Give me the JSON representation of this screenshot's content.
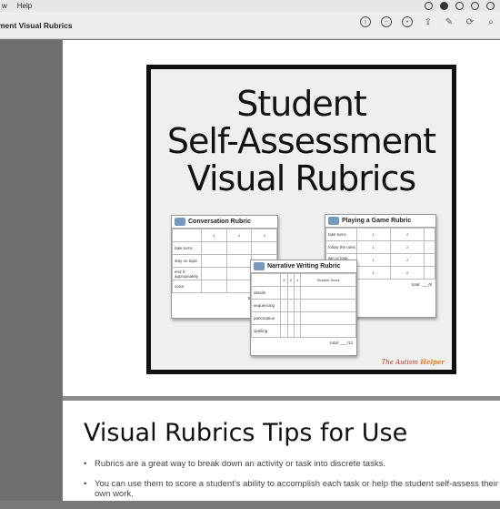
{
  "menubar": {
    "items": [
      "w",
      "Help"
    ]
  },
  "window": {
    "title": "ment Visual Rubrics"
  },
  "toolbar": [
    "info-icon",
    "zoom-out-icon",
    "zoom-in-icon",
    "share-icon",
    "markup-icon",
    "rotate-icon",
    "search-icon"
  ],
  "cover": {
    "title": "Student Self-Assessment Visual Rubrics",
    "title_lines": [
      "Student",
      "Self-Assessment",
      "Visual Rubrics"
    ],
    "brand_pre": "The Autism ",
    "brand_post": "Helper"
  },
  "rubrics": {
    "conversation": {
      "title": "Conversation Rubric",
      "score_label": "Student Score",
      "headers": [
        "",
        "1",
        "2",
        "3"
      ],
      "rows": [
        [
          "take turns",
          "",
          "",
          ""
        ],
        [
          "stay on topic",
          "",
          "",
          ""
        ],
        [
          "end it appropriately",
          "",
          "",
          ""
        ],
        [
          "voice",
          "",
          "",
          ""
        ]
      ]
    },
    "narrative": {
      "title": "Narrative Writing Rubric",
      "headers": [
        "",
        "3",
        "2",
        "1",
        "Student Score"
      ],
      "rows": [
        [
          "details",
          "",
          "",
          "",
          ""
        ],
        [
          "sequencing",
          "",
          "",
          "",
          ""
        ],
        [
          "punctuation",
          "",
          "",
          "",
          ""
        ],
        [
          "spelling",
          "",
          "",
          "",
          ""
        ]
      ],
      "total": "total: ___/12"
    },
    "game": {
      "title": "Playing a Game Rubric",
      "score_label": "Student Score",
      "headers": [
        "",
        "1",
        "2",
        ""
      ],
      "rows": [
        [
          "take turns",
          "1",
          "2",
          ""
        ],
        [
          "follow the rules",
          "1",
          "2",
          ""
        ],
        [
          "win or lose appropriately",
          "1",
          "2",
          ""
        ],
        [
          "help clean up",
          "1",
          "2",
          ""
        ]
      ],
      "total": "total: ___/8"
    }
  },
  "section": {
    "heading": "Visual Rubrics Tips for Use",
    "bullets": [
      "Rubrics are a great way to break down an activity or task into discrete tasks.",
      "You can use them to score a student's ability to accomplish each task or help the student self-assess their own work."
    ]
  }
}
